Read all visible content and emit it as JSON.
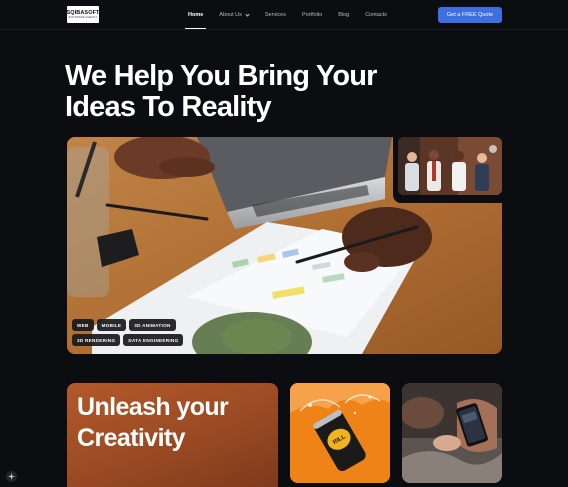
{
  "brand": {
    "logo_main": "SQIBASOFT",
    "logo_sub": "SOFTWARE AGENCY"
  },
  "nav": {
    "items": [
      {
        "label": "Home",
        "active": true
      },
      {
        "label": "About Us",
        "dropdown": true
      },
      {
        "label": "Services"
      },
      {
        "label": "Portfolio"
      },
      {
        "label": "Blog"
      },
      {
        "label": "Contacts"
      }
    ],
    "cta_label": "Get a FREE Quote"
  },
  "hero": {
    "title_line1": "We Help You Bring Your",
    "title_line2": "Ideas To Reality",
    "tags": [
      "WEB",
      "MOBILE",
      "3D ANIMATION",
      "3D RENDERING",
      "DATA ENGINEERING"
    ]
  },
  "cards": {
    "creativity_line1": "Unleash your",
    "creativity_line2": "Creativity",
    "can_label": "RILL"
  },
  "colors": {
    "accent": "#3d6fe0",
    "background": "#0c0d10",
    "card_orange": "#a8522a",
    "can_bg": "#f08317"
  },
  "icons": {
    "corner": "sparkle-icon",
    "dropdown": "chevron-down-icon"
  }
}
